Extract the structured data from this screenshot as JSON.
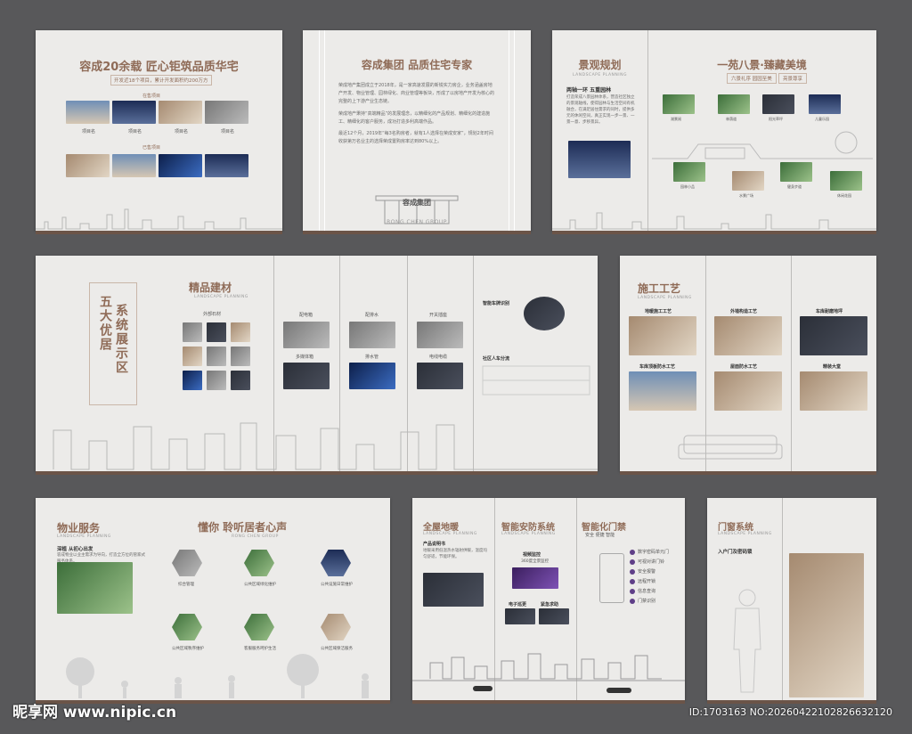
{
  "panel1": {
    "title": "容成20余载  匠心钜筑品质华宅",
    "subtitle": "开发近18个项目，累计开发面积约200万方",
    "tag1": "在售项目",
    "tag2": "已售项目",
    "captions": [
      "项目名",
      "项目名",
      "项目名",
      "项目名"
    ]
  },
  "panel2": {
    "title": "容成集团 品质住宅专家",
    "para1": "荣成地产集团成立于2018年，是一家高速发展的新锐实力房企，业务涵盖房地产开发、物业管理、园林绿化、商业管理等板块，形成了以房地产开发为核心的完整的上下游产业生态链。",
    "para2": "荣成地产秉持“高端精品”的发展理念，以精细化的产品规划、精细化的建造施工、精细化的客户服务，成功打造多利高端作品。",
    "para3": "最近12个月，2019年“每3名购房者，就有1人选择在荣成安家”，规划2年时间收获第万名业主的选择荣成置购房率达到80%以上。",
    "gate_name": "容成集团",
    "gate_en": "RONG CHEN GROUP"
  },
  "panel3": {
    "title": "景观规划",
    "sub": "LANDSCAPE PLANNING",
    "heading": "两轴一环  五重园林",
    "para": "打造荣成八景园林体系，营造社区独立的景观轴线，使得园林与生活空间有机融合，在满足居住需求的同时，提供多元的休闲空间，真正实现一步一景、一景一意、步移景异。"
  },
  "panel4": {
    "title": "一苑八景·臻藏美境",
    "pill1": "六景礼序  园园至美",
    "pill2": "亮景尊享",
    "captions": [
      "湖景阅",
      "林荫道",
      "阳光草坪",
      "儿童乐园",
      "园林小品",
      "水景广场",
      "健身步道",
      "休闲花园"
    ]
  },
  "panel5": {
    "vertical_a": "五大优居",
    "vertical_b": "系统展示区",
    "title": "精品建材",
    "sub": "LANDSCAPE PLANNING",
    "label_stone": "外部石材",
    "label_a": "配电箱",
    "label_b": "配排水",
    "label_c": "多媒体箱",
    "label_d": "排水管",
    "label_e": "开关插座",
    "label_f": "电线电缆",
    "label_g": "智能车牌识别",
    "label_h": "社区人车分流"
  },
  "panel6": {
    "title": "施工工艺",
    "sub": "LANDSCAPE PLANNING",
    "items": [
      "地暖施工工艺",
      "外墙构造工艺",
      "车库耐磨地坪",
      "车库顶板防水工艺",
      "屋面防水工艺",
      "精装大堂"
    ]
  },
  "panel7": {
    "title": "物业服务",
    "sub": "LANDSCAPE PLANNING",
    "heading": "深植 从初心出发",
    "para": "容成物业以业主需求为导向，打造全方位的管家式服务体系。",
    "voice_title": "懂你  聆听居者心声",
    "voice_sub": "RONG CHEN GROUP",
    "hex_labels": [
      "综合管理",
      "公共区域绿化维护",
      "公共设施日常维护",
      "公共区域秩序维护",
      "客服服务呵护生活",
      "公共区域保洁服务"
    ]
  },
  "panel8": {
    "title_a": "全屋地暖",
    "title_b": "智能安防系统",
    "title_c": "智能化门禁",
    "sub": "LANDSCAPE PLANNING",
    "intro_head": "产品说明书",
    "intro": "地暖采用低温热水辐射供暖，温度均匀舒适，节能环保。",
    "video": "视频监控",
    "video_sub": "360度全景监控",
    "patrol": "电子巡更",
    "alarm": "紧急求助",
    "door_sub": "安全  便捷  智能",
    "steps": [
      "数字密码单元门",
      "可视对讲门铃",
      "安全报警",
      "远程开锁",
      "信息查询",
      "门禁识别"
    ]
  },
  "panel9": {
    "title": "门窗系统",
    "sub": "LANDSCAPE PLANNING",
    "heading": "入户门及密码锁"
  },
  "watermark": {
    "logo": "昵享网 www.nipic.cn",
    "id": "ID:1703163 NO:20260422102826632120"
  }
}
